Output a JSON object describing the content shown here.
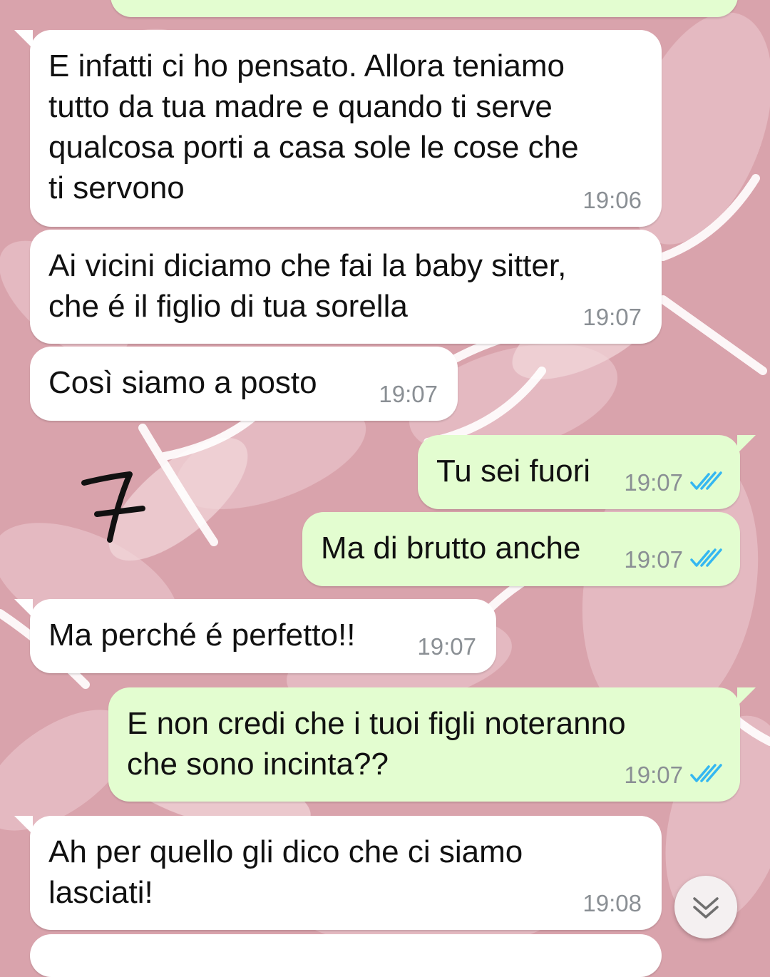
{
  "chat": {
    "messages": [
      {
        "direction": "in",
        "text": "E infatti ci ho pensato. Allora teniamo\ntutto da tua madre e quando ti serve\nqualcosa porti a casa sole le cose che\nti servono",
        "time": "19:06"
      },
      {
        "direction": "in",
        "text": "Ai vicini diciamo che fai la baby sitter,\nche é il figlio di tua sorella",
        "time": "19:07"
      },
      {
        "direction": "in",
        "text": "Così siamo a posto",
        "time": "19:07"
      },
      {
        "direction": "out",
        "text": "Tu sei fuori",
        "time": "19:07",
        "status": "read"
      },
      {
        "direction": "out",
        "text": "Ma di brutto anche",
        "time": "19:07",
        "status": "read"
      },
      {
        "direction": "in",
        "text": "Ma perché é perfetto!!",
        "time": "19:07"
      },
      {
        "direction": "out",
        "text": "E non credi che i tuoi figli noteranno\nche sono incinta??",
        "time": "19:07",
        "status": "read"
      },
      {
        "direction": "in",
        "text": "Ah per quello gli dico che ci siamo\nlasciati!",
        "time": "19:08"
      }
    ]
  },
  "annotation": {
    "text": "7"
  },
  "colors": {
    "wallpaper": "#d9a3ac",
    "incoming_bubble": "#ffffff",
    "outgoing_bubble": "#e3fdd0",
    "read_ticks": "#34b7f1",
    "timestamp": "#8a8f94"
  },
  "icons": {
    "read_receipt": "double-check-icon",
    "scroll_down": "chevron-double-down-icon"
  }
}
